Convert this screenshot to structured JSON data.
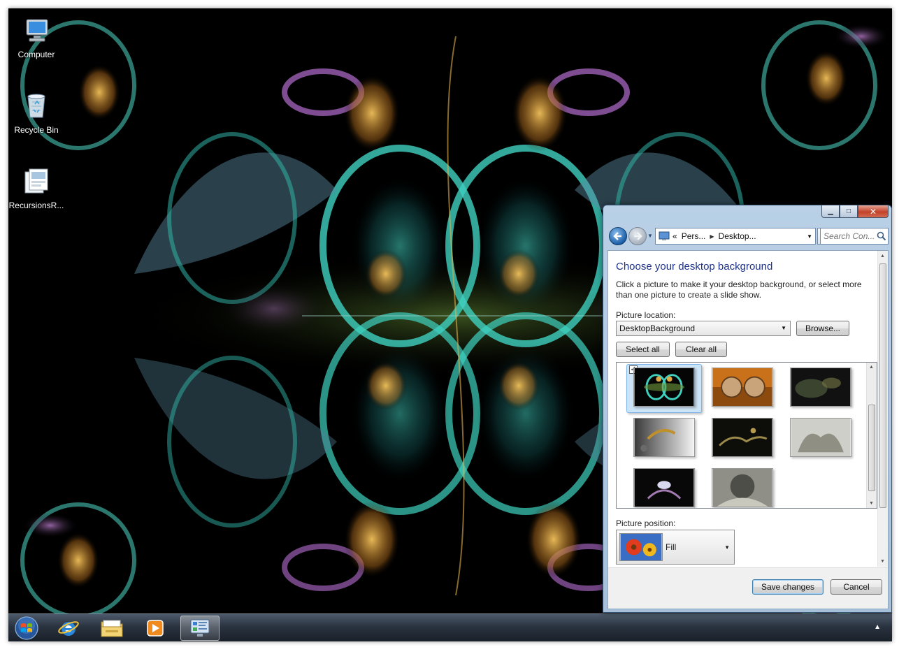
{
  "desktop": {
    "icons": [
      {
        "label": "Computer",
        "icon": "computer-icon"
      },
      {
        "label": "Recycle Bin",
        "icon": "recycle-bin-icon"
      },
      {
        "label": "RecursionsR...",
        "icon": "theme-file-icon"
      }
    ]
  },
  "taskbar": {
    "items": [
      {
        "name": "start-orb",
        "icon": "windows-logo-icon"
      },
      {
        "name": "internet-explorer",
        "icon": "internet-explorer-icon"
      },
      {
        "name": "windows-explorer",
        "icon": "folder-icon"
      },
      {
        "name": "media-player",
        "icon": "media-player-icon"
      },
      {
        "name": "control-panel",
        "icon": "control-panel-icon",
        "active": true
      }
    ],
    "tray_arrow": "▲"
  },
  "window": {
    "caption": {
      "minimize": "▁",
      "maximize": "□",
      "close": "✕"
    },
    "nav": {
      "back": "←",
      "forward": "→",
      "dropdown": "▼",
      "address_prefix": "«",
      "crumbs": [
        "Pers...",
        "Desktop..."
      ],
      "crumb_sep": "▶",
      "refresh": "↻",
      "search_placeholder": "Search Con...",
      "search_icon": "magnifier-icon"
    },
    "title": "Choose your desktop background",
    "description": "Click a picture to make it your desktop background, or select more than one picture to create a slide show.",
    "picture_location_label": "Picture location:",
    "picture_location_value": "DesktopBackground",
    "browse_label": "Browse...",
    "select_all_label": "Select all",
    "clear_all_label": "Clear all",
    "thumbnails_selected_check": "✓",
    "picture_position_label": "Picture position:",
    "picture_position_value": "Fill",
    "save_label": "Save changes",
    "cancel_label": "Cancel"
  },
  "colors": {
    "title_blue": "#1e3287",
    "taskbar": "#2a3340",
    "window_frame": "#b9d0e6"
  }
}
